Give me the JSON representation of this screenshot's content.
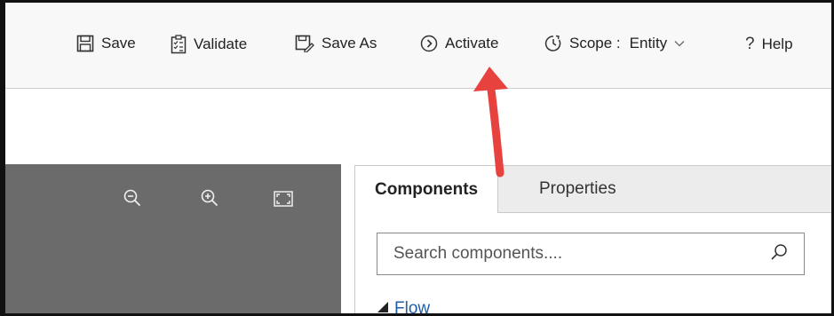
{
  "toolbar": {
    "save_label": "Save",
    "validate_label": "Validate",
    "save_as_label": "Save As",
    "activate_label": "Activate",
    "scope_label": "Scope :",
    "scope_value": "Entity",
    "help_label": "Help"
  },
  "panel": {
    "tabs": [
      {
        "label": "Components",
        "active": true
      },
      {
        "label": "Properties",
        "active": false
      }
    ],
    "search_placeholder": "Search components....",
    "tree_item_label": "Flow"
  },
  "colors": {
    "canvas_bg": "#6b6b6b",
    "annotation_arrow": "#e8423f",
    "link": "#1f5fa8"
  },
  "icons": [
    "save-icon",
    "validate-icon",
    "save-as-icon",
    "activate-icon",
    "scope-icon",
    "help-icon",
    "zoom-out-icon",
    "zoom-in-icon",
    "fit-screen-icon",
    "search-icon",
    "expand-triangle-icon"
  ]
}
